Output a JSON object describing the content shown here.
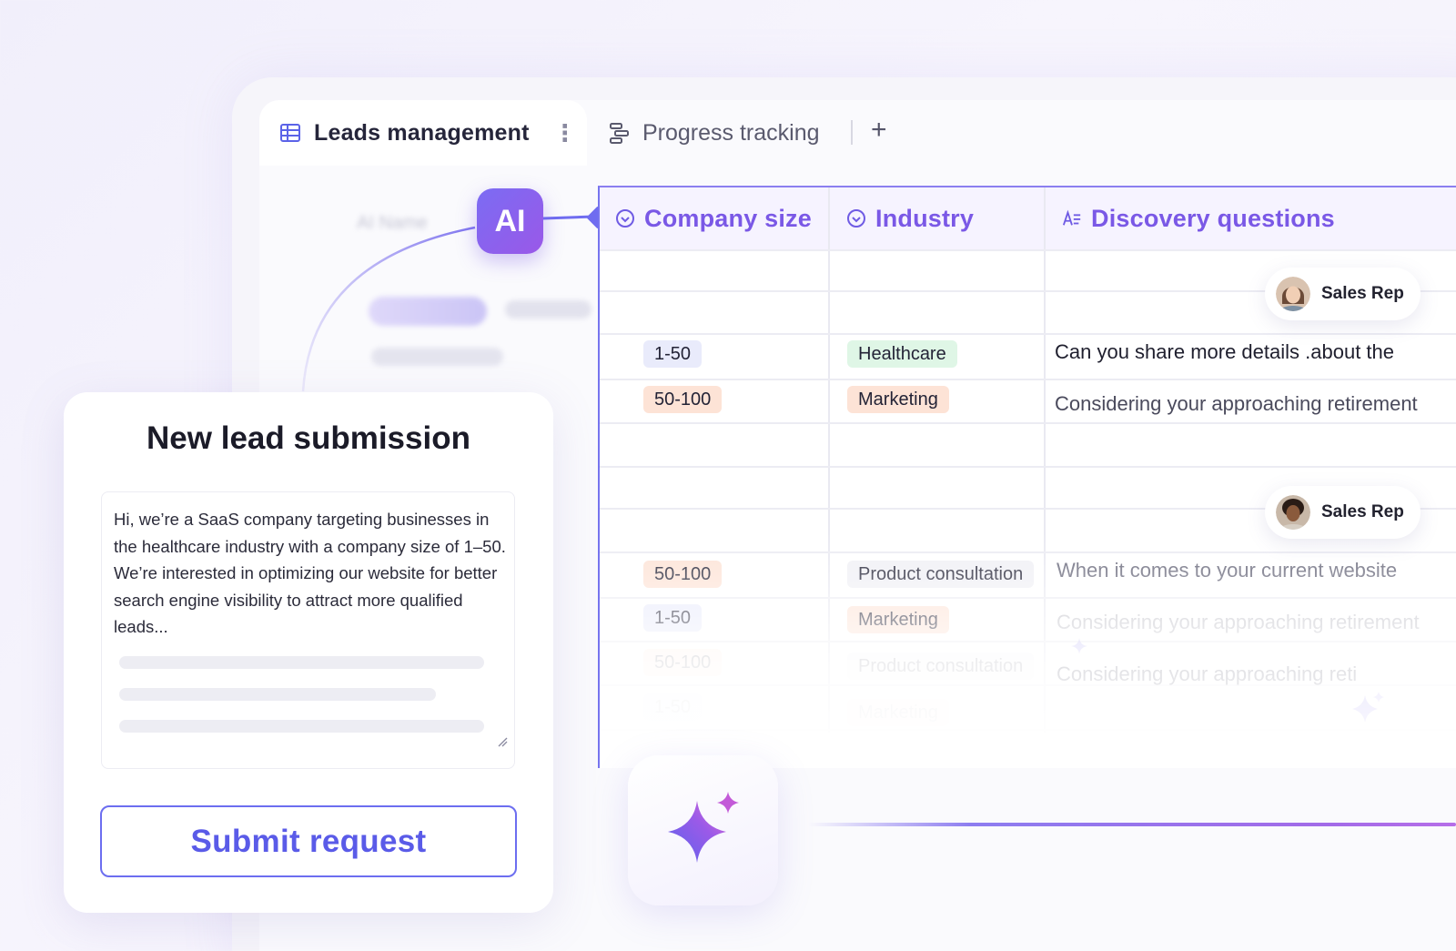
{
  "tabs": {
    "active": {
      "label": "Leads management",
      "icon": "table-grid-icon"
    },
    "second": {
      "label": "Progress tracking",
      "icon": "progress-steps-icon"
    },
    "add_label": "+"
  },
  "ghost": {
    "name_label": "AI Name"
  },
  "ai_badge": {
    "label": "AI"
  },
  "table": {
    "columns": [
      {
        "label": "Company size",
        "icon": "select-circle-icon"
      },
      {
        "label": "Industry",
        "icon": "select-circle-icon"
      },
      {
        "label": "Discovery questions",
        "icon": "ai-text-icon"
      }
    ],
    "rows": [
      {
        "size": "1-50",
        "size_color": "blue",
        "industry": "Healthcare",
        "industry_color": "green",
        "question": "Can you share more details .about the"
      },
      {
        "size": "50-100",
        "size_color": "orange",
        "industry": "Marketing",
        "industry_color": "orange",
        "question": "Considering your approaching retirement"
      },
      {
        "size": "50-100",
        "size_color": "orange",
        "industry": "Product consultation",
        "industry_color": "gray",
        "question": "When it comes to your current website"
      },
      {
        "size": "1-50",
        "size_color": "blue",
        "industry": "Marketing",
        "industry_color": "orange",
        "question": "Considering your approaching retirement"
      },
      {
        "size": "50-100",
        "size_color": "orange",
        "industry": "Product consultation",
        "industry_color": "gray",
        "question": "Considering your approaching reti"
      },
      {
        "size": "1-50",
        "size_color": "blue",
        "industry": "Marketing",
        "industry_color": "orange",
        "question": ""
      }
    ],
    "reps": [
      {
        "label": "Sales Rep"
      },
      {
        "label": "Sales Rep"
      }
    ]
  },
  "form": {
    "title": "New lead submission",
    "message": "Hi, we’re a SaaS company targeting businesses in the healthcare industry with a company size of 1–50. We’re interested in optimizing our website for better search engine visibility to attract more qualified leads...",
    "submit_label": "Submit request"
  },
  "colors": {
    "accent": "#6c6ef0",
    "ai_gradient_start": "#7b6cf3",
    "ai_gradient_end": "#9a58e8",
    "header_text": "#7a58e6"
  }
}
